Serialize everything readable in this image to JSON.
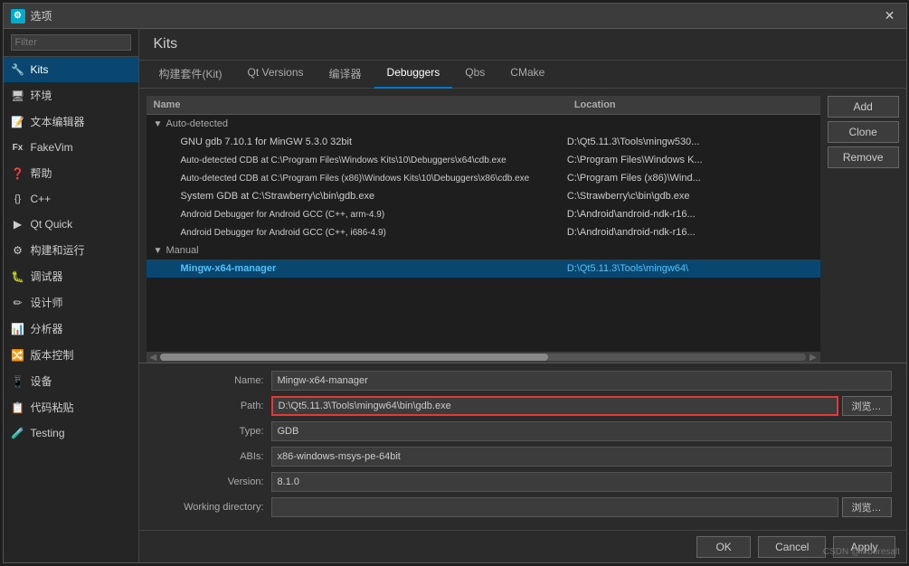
{
  "dialog": {
    "title": "选项",
    "title_icon": "⚙"
  },
  "sidebar": {
    "filter_placeholder": "Filter",
    "items": [
      {
        "id": "kits",
        "label": "Kits",
        "icon": "🔧",
        "active": true
      },
      {
        "id": "env",
        "label": "环境",
        "icon": "🖥"
      },
      {
        "id": "text-editor",
        "label": "文本编辑器",
        "icon": "📝"
      },
      {
        "id": "fakevim",
        "label": "FakeVim",
        "icon": "Fx"
      },
      {
        "id": "help",
        "label": "帮助",
        "icon": "?"
      },
      {
        "id": "cpp",
        "label": "C++",
        "icon": "{}"
      },
      {
        "id": "qt-quick",
        "label": "Qt Quick",
        "icon": "▶"
      },
      {
        "id": "build-run",
        "label": "构建和运行",
        "icon": "⚙"
      },
      {
        "id": "debugger",
        "label": "调试器",
        "icon": "🐛"
      },
      {
        "id": "designer",
        "label": "设计师",
        "icon": "✏"
      },
      {
        "id": "analyzer",
        "label": "分析器",
        "icon": "📊"
      },
      {
        "id": "vcs",
        "label": "版本控制",
        "icon": "🔀"
      },
      {
        "id": "devices",
        "label": "设备",
        "icon": "📱"
      },
      {
        "id": "code-paste",
        "label": "代码粘贴",
        "icon": "📋"
      },
      {
        "id": "testing",
        "label": "Testing",
        "icon": "🧪"
      }
    ]
  },
  "main": {
    "title": "Kits",
    "tabs": [
      {
        "id": "kit",
        "label": "构建套件(Kit)"
      },
      {
        "id": "qt-versions",
        "label": "Qt Versions"
      },
      {
        "id": "compilers",
        "label": "编译器"
      },
      {
        "id": "debuggers",
        "label": "Debuggers",
        "active": true
      },
      {
        "id": "qbs",
        "label": "Qbs"
      },
      {
        "id": "cmake",
        "label": "CMake"
      }
    ],
    "table": {
      "headers": {
        "name": "Name",
        "location": "Location"
      },
      "rows": [
        {
          "indent": 0,
          "arrow": "▼",
          "label": "Auto-detected",
          "location": "",
          "bold": false,
          "group": true
        },
        {
          "indent": 1,
          "arrow": "",
          "label": "GNU gdb 7.10.1 for MinGW 5.3.0 32bit",
          "location": "D:\\Qt5.11.3\\Tools\\mingw530...",
          "bold": false
        },
        {
          "indent": 1,
          "arrow": "",
          "label": "Auto-detected CDB at C:\\Program Files\\Windows Kits\\10\\Debuggers\\x64\\cdb.exe",
          "location": "C:\\Program Files\\Windows K...",
          "bold": false
        },
        {
          "indent": 1,
          "arrow": "",
          "label": "Auto-detected CDB at C:\\Program Files (x86)\\Windows Kits\\10\\Debuggers\\x86\\cdb.exe",
          "location": "C:\\Program Files (x86)\\Wind...",
          "bold": false
        },
        {
          "indent": 1,
          "arrow": "",
          "label": "System GDB at C:\\Strawberry\\c\\bin\\gdb.exe",
          "location": "C:\\Strawberry\\c\\bin\\gdb.exe...",
          "bold": false
        },
        {
          "indent": 1,
          "arrow": "",
          "label": "Android Debugger for Android GCC (C++, arm-4.9)",
          "location": "D:\\Android\\android-ndk-r16...",
          "bold": false
        },
        {
          "indent": 1,
          "arrow": "",
          "label": "Android Debugger for Android GCC (C++, i686-4.9)",
          "location": "D:\\Android\\android-ndk-r16...",
          "bold": false
        },
        {
          "indent": 0,
          "arrow": "▼",
          "label": "Manual",
          "location": "",
          "bold": false,
          "group": true
        },
        {
          "indent": 1,
          "arrow": "",
          "label": "Mingw-x64-manager",
          "location": "D:\\Qt5.11.3\\Tools\\mingw64\\",
          "bold": true,
          "selected": true
        }
      ]
    },
    "action_buttons": {
      "add": "Add",
      "clone": "Clone",
      "remove": "Remove"
    },
    "details": {
      "name_label": "Name:",
      "name_value": "Mingw-x64-manager",
      "path_label": "Path:",
      "path_value": "D:\\Qt5.11.3\\Tools\\mingw64\\bin\\gdb.exe",
      "type_label": "Type:",
      "type_value": "GDB",
      "abis_label": "ABIs:",
      "abis_value": "x86-windows-msys-pe-64bit",
      "version_label": "Version:",
      "version_value": "8.1.0",
      "working_dir_label": "Working directory:",
      "working_dir_value": "",
      "browse_label": "浏览…",
      "browse2_label": "浏览…"
    },
    "bottom_buttons": {
      "ok": "OK",
      "cancel": "Cancel",
      "apply": "Apply"
    }
  },
  "watermark": "CSDN @Mooresalt"
}
